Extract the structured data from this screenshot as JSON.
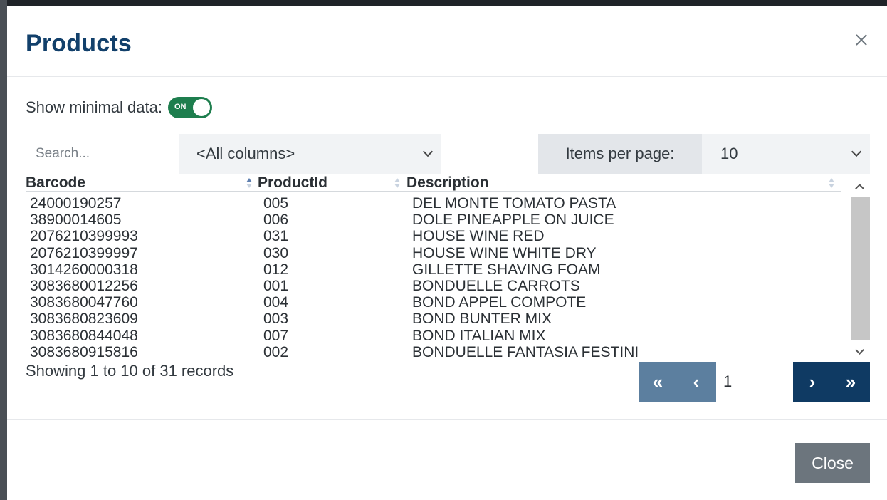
{
  "modal": {
    "title": "Products",
    "close_icon": "close-icon"
  },
  "options": {
    "minimal_label": "Show minimal data:",
    "toggle_state": "ON",
    "toggle_color": "#1e7e4e"
  },
  "search": {
    "placeholder": "Search...",
    "value": ""
  },
  "column_filter": {
    "selected": "<All columns>"
  },
  "items_per_page": {
    "label": "Items per page:",
    "selected": "10"
  },
  "table": {
    "headers": [
      "Barcode",
      "ProductId",
      "Description"
    ],
    "rows": [
      [
        "24000190257",
        "005",
        "DEL MONTE TOMATO PASTA"
      ],
      [
        "38900014605",
        "006",
        "DOLE PINEAPPLE ON JUICE"
      ],
      [
        "2076210399993",
        "031",
        "HOUSE WINE RED"
      ],
      [
        "2076210399997",
        "030",
        "HOUSE WINE WHITE DRY"
      ],
      [
        "3014260000318",
        "012",
        "GILLETTE SHAVING FOAM"
      ],
      [
        "3083680012256",
        "001",
        "BONDUELLE CARROTS"
      ],
      [
        "3083680047760",
        "004",
        "BOND APPEL COMPOTE"
      ],
      [
        "3083680823609",
        "003",
        "BOND BUNTER MIX"
      ],
      [
        "3083680844048",
        "007",
        "BOND ITALIAN MIX"
      ],
      [
        "3083680915816",
        "002",
        "BONDUELLE FANTASIA FESTINI"
      ]
    ]
  },
  "pagination": {
    "summary": "Showing 1 to 10 of 31 records",
    "first": "«",
    "prev": "‹",
    "page": "1",
    "next": "›",
    "last": "»"
  },
  "footer": {
    "close_label": "Close"
  }
}
